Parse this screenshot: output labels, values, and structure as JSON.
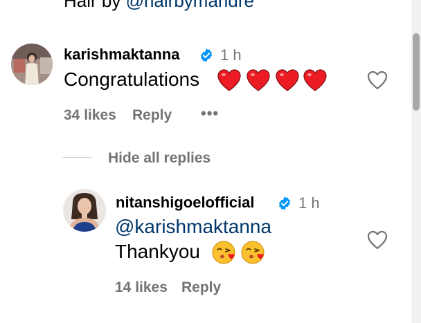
{
  "caption": {
    "prefix": "Hair by ",
    "mention": "@hairbymandre"
  },
  "comment": {
    "username": "karishmaktanna",
    "verified": true,
    "time": "1 h",
    "text": "Congratulations",
    "emoji": "❤️❤️❤️❤️",
    "likes": "34 likes",
    "reply_label": "Reply",
    "more_label": "•••"
  },
  "hide_replies_label": "Hide all replies",
  "reply": {
    "username": "nitanshigoelofficial",
    "verified": true,
    "time": "1 h",
    "mention": "@karishmaktanna",
    "text": "Thankyou",
    "emoji": "😘😘",
    "likes": "14 likes",
    "reply_label": "Reply"
  },
  "colors": {
    "verified_badge": "#0095f6",
    "heart_red": "#ed1c24",
    "mention_blue": "#00376b",
    "secondary_text": "#737373"
  }
}
